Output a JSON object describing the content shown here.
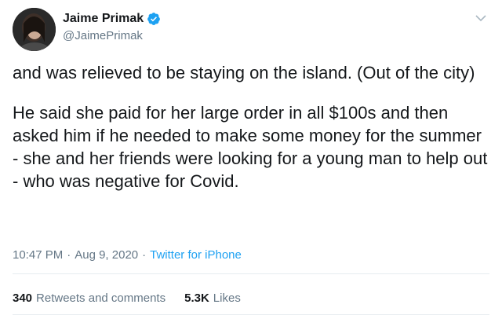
{
  "author": {
    "display_name": "Jaime Primak",
    "handle": "@JaimePrimak",
    "verified": true,
    "avatar_icon": "avatar-photo"
  },
  "tweet": {
    "paragraph_1": "and was relieved to be staying on the island. (Out of the city)",
    "paragraph_2": "He said she paid for her large order in all $100s and then asked him if he needed to make some money for the summer - she and her friends were looking for a young man to help out - who was negative for Covid."
  },
  "meta": {
    "time": "10:47 PM",
    "separator": "·",
    "date": "Aug 9, 2020",
    "separator2": "·",
    "source": "Twitter for iPhone"
  },
  "stats": {
    "retweets_count": "340",
    "retweets_label": "Retweets and comments",
    "likes_count": "5.3K",
    "likes_label": "Likes"
  },
  "colors": {
    "accent": "#1da1f2",
    "secondary_text": "#657786",
    "primary_text": "#14171a"
  }
}
